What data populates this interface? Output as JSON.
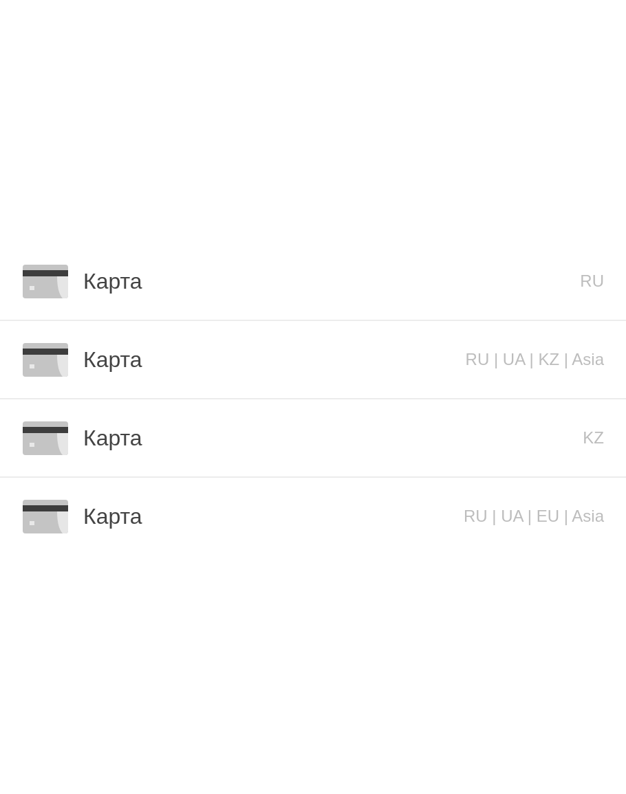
{
  "payment_methods": [
    {
      "label": "Карта",
      "regions": "RU"
    },
    {
      "label": "Карта",
      "regions": "RU | UA | KZ | Asia"
    },
    {
      "label": "Карта",
      "regions": "KZ"
    },
    {
      "label": "Карта",
      "regions": "RU | UA | EU | Asia"
    }
  ]
}
